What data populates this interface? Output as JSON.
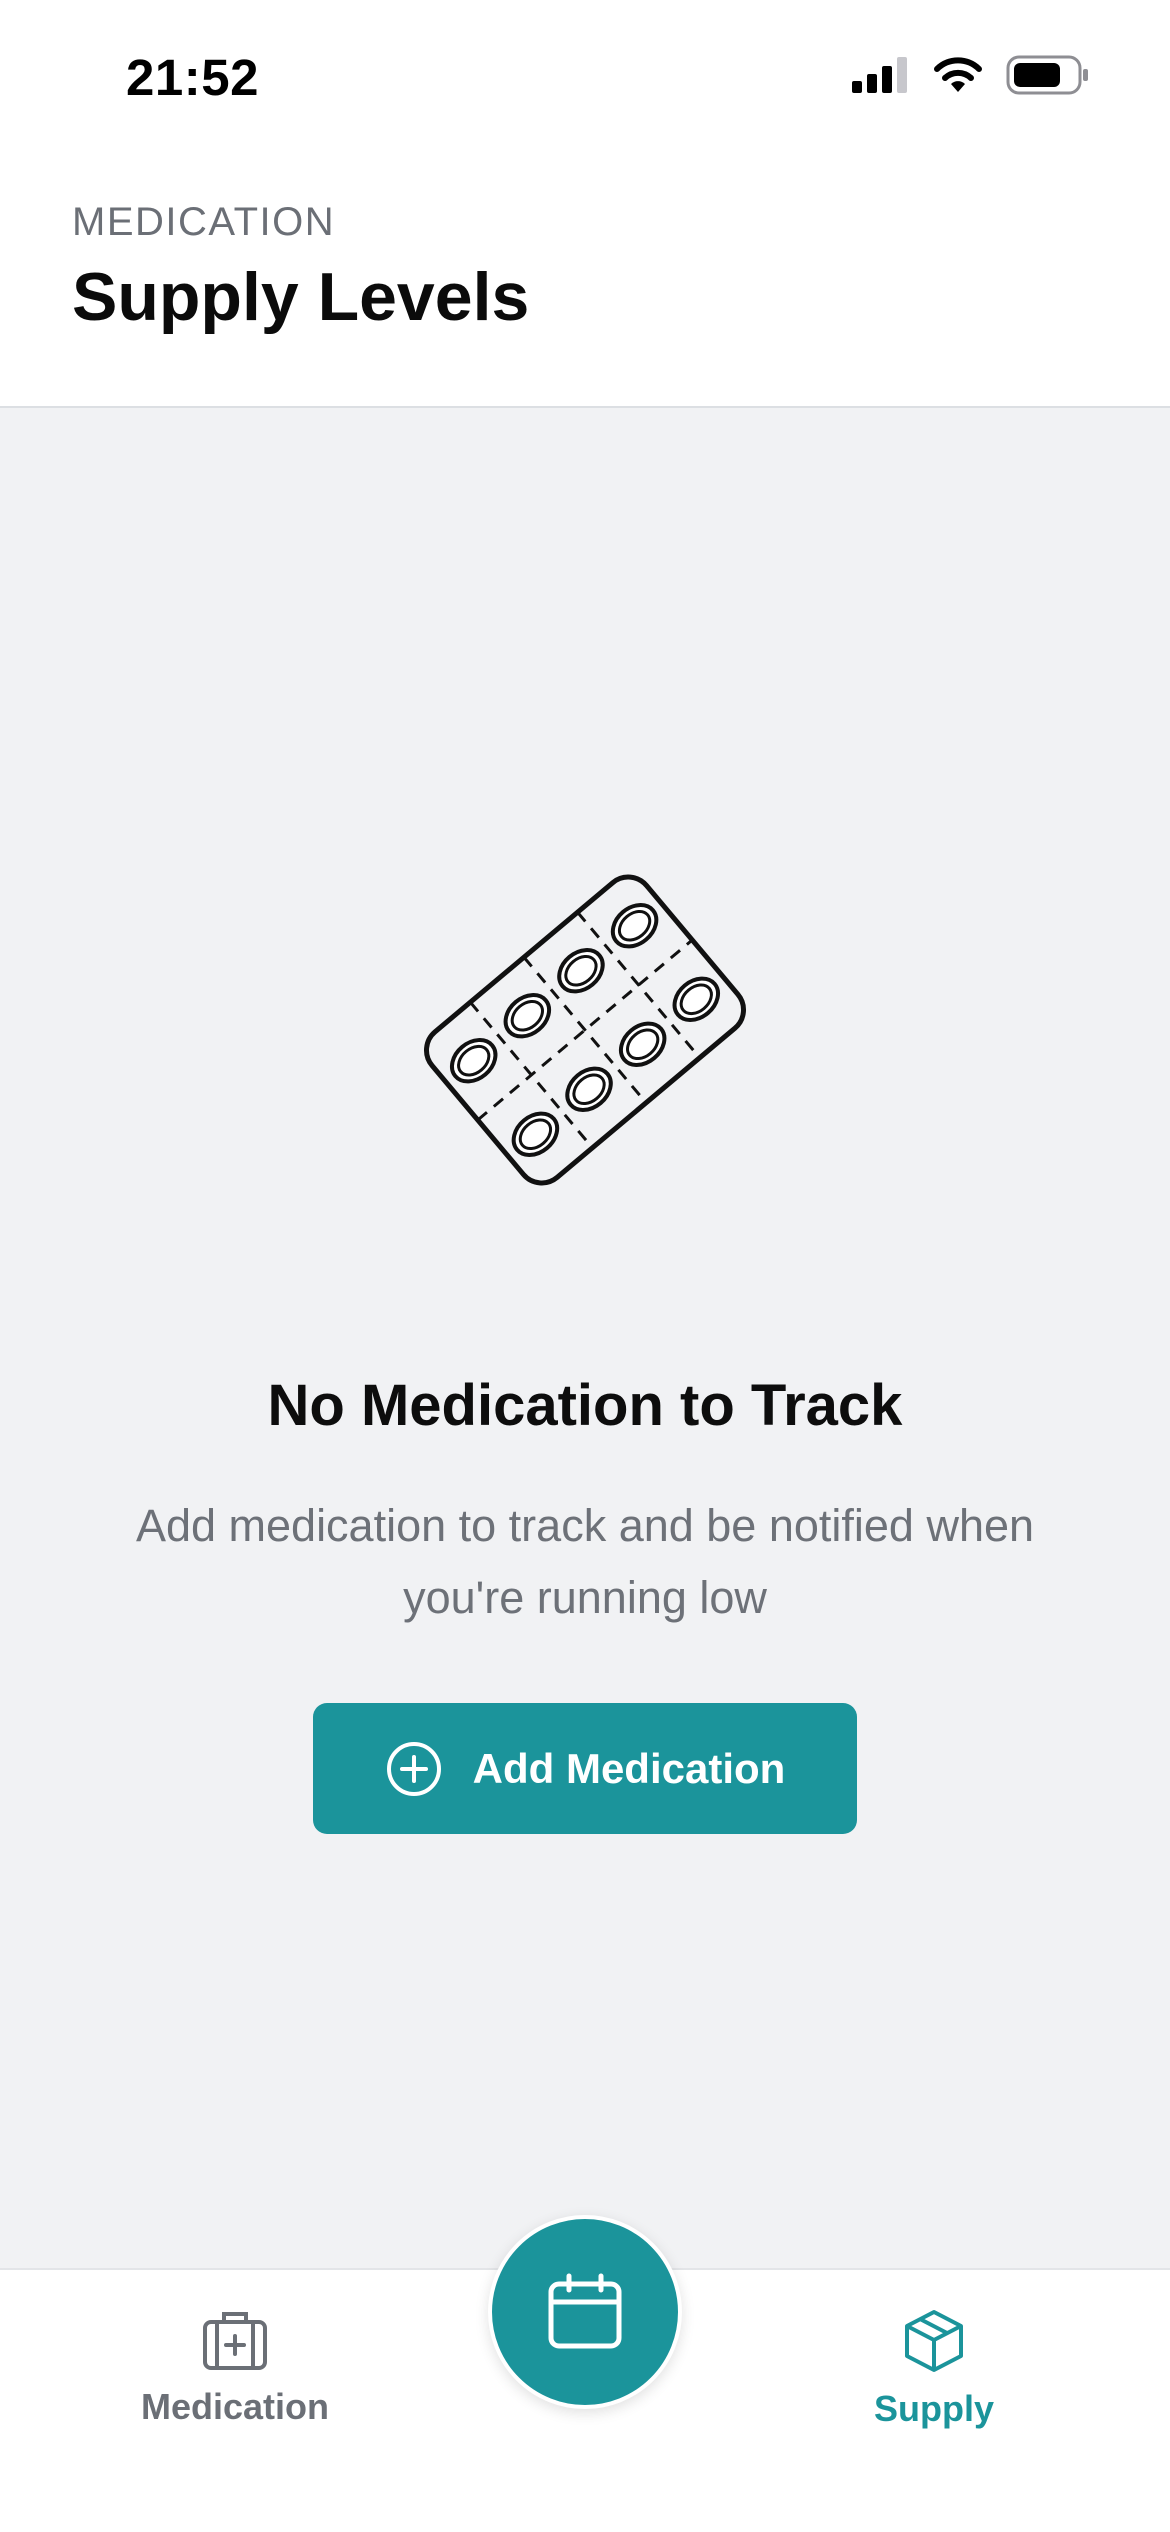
{
  "status_bar": {
    "time": "21:52",
    "icons": [
      "cellular-signal-icon",
      "wifi-icon",
      "battery-icon"
    ]
  },
  "header": {
    "eyebrow": "MEDICATION",
    "title": "Supply Levels"
  },
  "empty_state": {
    "illustration": "pill-blister-pack-icon",
    "title": "No Medication to Track",
    "description": "Add medication to track and be notified when you're running low",
    "button_label": "Add Medication",
    "button_icon": "plus-circle-icon"
  },
  "tab_bar": {
    "tabs": [
      {
        "label": "Medication",
        "icon": "medical-kit-icon",
        "active": false
      },
      {
        "label": "Supply",
        "icon": "box-icon",
        "active": true
      }
    ],
    "center_button_icon": "calendar-icon"
  },
  "colors": {
    "accent": "#1b949b",
    "background": "#f1f2f4",
    "muted_text": "#6d7178"
  }
}
